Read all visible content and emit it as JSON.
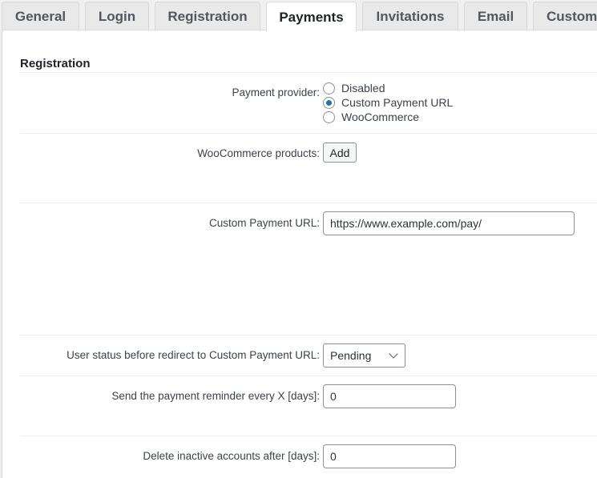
{
  "tabs": [
    {
      "label": "General",
      "active": false
    },
    {
      "label": "Login",
      "active": false
    },
    {
      "label": "Registration",
      "active": false
    },
    {
      "label": "Payments",
      "active": true
    },
    {
      "label": "Invitations",
      "active": false
    },
    {
      "label": "Email",
      "active": false
    },
    {
      "label": "Custom",
      "active": false
    }
  ],
  "section": {
    "title": "Registration"
  },
  "fields": {
    "payment_provider": {
      "label": "Payment provider:",
      "options": [
        "Disabled",
        "Custom Payment URL",
        "WooCommerce"
      ],
      "selected": "Custom Payment URL"
    },
    "woocommerce_products": {
      "label": "WooCommerce products:",
      "button_label": "Add"
    },
    "custom_payment_url": {
      "label": "Custom Payment URL:",
      "value": "https://www.example.com/pay/"
    },
    "user_status": {
      "label": "User status before redirect to Custom Payment URL:",
      "value": "Pending"
    },
    "reminder_days": {
      "label": "Send the payment reminder every X [days]:",
      "value": "0"
    },
    "delete_inactive_days": {
      "label": "Delete inactive accounts after [days]:",
      "value": "0"
    }
  },
  "colors": {
    "accent": "#2271b1"
  }
}
